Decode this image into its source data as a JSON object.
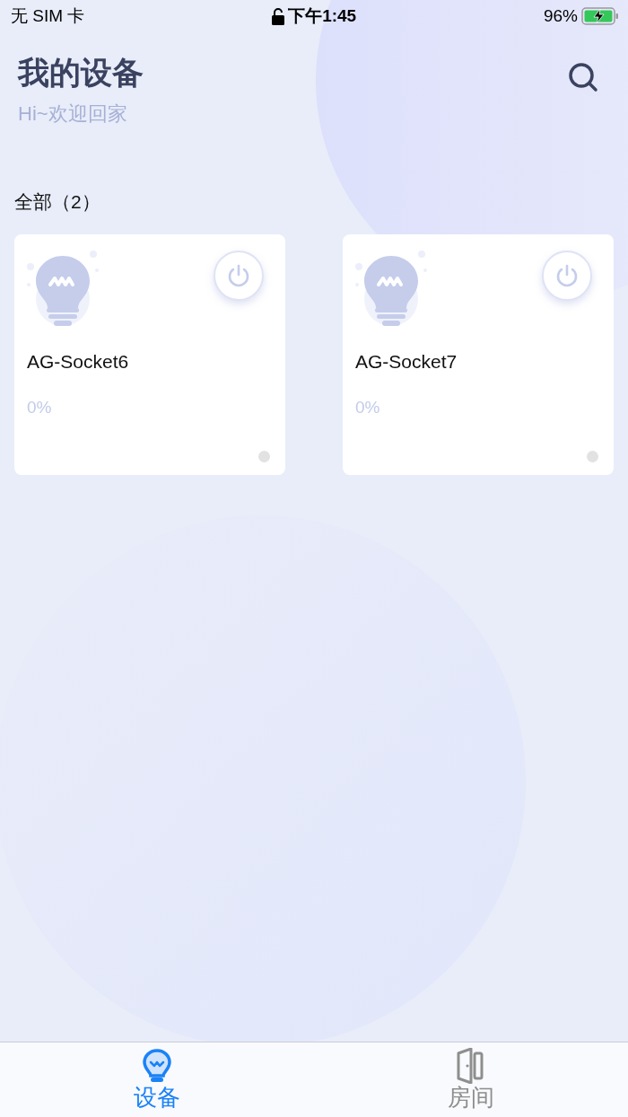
{
  "status_bar": {
    "carrier": "无 SIM 卡",
    "time": "下午1:45",
    "battery": "96%",
    "charging": true
  },
  "header": {
    "title": "我的设备",
    "subtitle": "Hi~欢迎回家"
  },
  "section": {
    "label": "全部（2）"
  },
  "devices": [
    {
      "name": "AG-Socket6",
      "reading": "0%",
      "on": false,
      "online": false
    },
    {
      "name": "AG-Socket7",
      "reading": "0%",
      "on": false,
      "online": false
    }
  ],
  "tabs": [
    {
      "kind": "devices",
      "label": "设备",
      "selected": true
    },
    {
      "kind": "rooms",
      "label": "房间",
      "selected": false
    }
  ]
}
